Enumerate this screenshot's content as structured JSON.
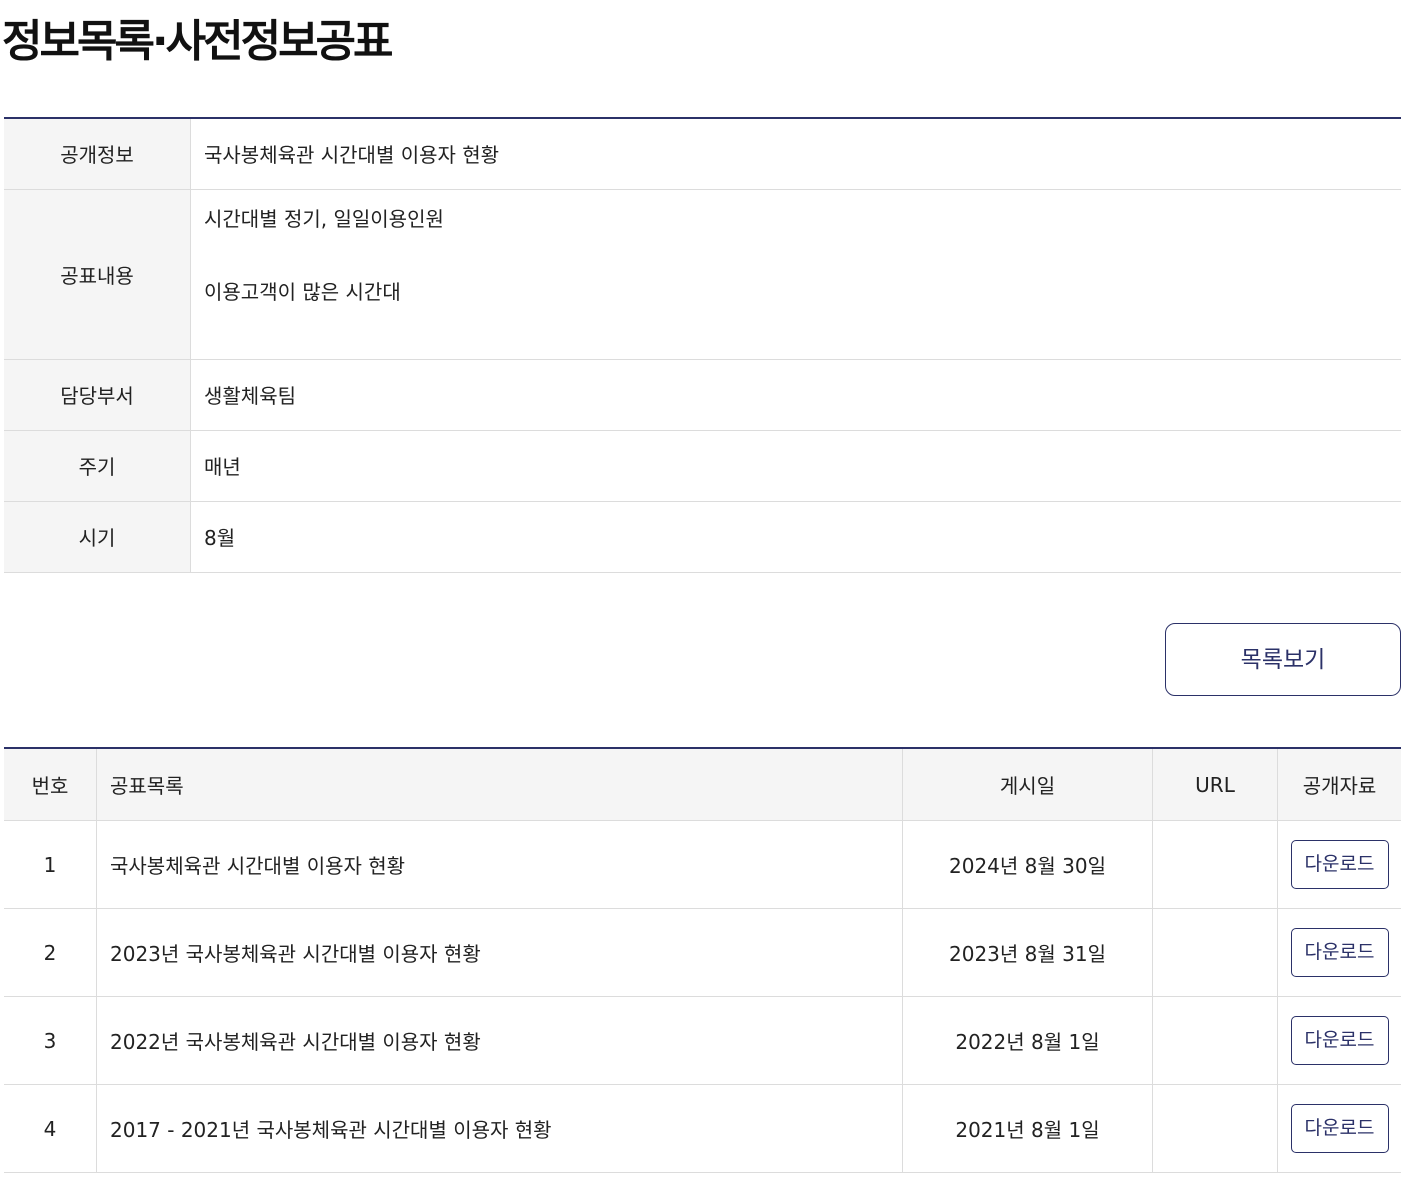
{
  "page": {
    "title": "정보목록·사전정보공표"
  },
  "info": {
    "rows": [
      {
        "label": "공개정보",
        "value": "국사봉체육관 시간대별 이용자 현황"
      },
      {
        "label": "공표내용",
        "value_line1": "시간대별 정기, 일일이용인원",
        "value_line2": "이용고객이 많은 시간대"
      },
      {
        "label": "담당부서",
        "value": "생활체육팀"
      },
      {
        "label": "주기",
        "value": "매년"
      },
      {
        "label": "시기",
        "value": "8월"
      }
    ]
  },
  "actions": {
    "list_button_label": "목록보기"
  },
  "announcements": {
    "headers": {
      "number": "번호",
      "title": "공표목록",
      "date": "게시일",
      "url": "URL",
      "file": "공개자료"
    },
    "rows": [
      {
        "number": "1",
        "title": "국사봉체육관 시간대별 이용자 현황",
        "date": "2024년 8월 30일",
        "url": "",
        "download_label": "다운로드"
      },
      {
        "number": "2",
        "title": "2023년 국사봉체육관 시간대별 이용자 현황",
        "date": "2023년 8월 31일",
        "url": "",
        "download_label": "다운로드"
      },
      {
        "number": "3",
        "title": "2022년 국사봉체육관 시간대별 이용자 현황",
        "date": "2022년 8월 1일",
        "url": "",
        "download_label": "다운로드"
      },
      {
        "number": "4",
        "title": "2017 - 2021년 국사봉체육관 시간대별 이용자 현황",
        "date": "2021년 8월 1일",
        "url": "",
        "download_label": "다운로드"
      }
    ]
  },
  "colors": {
    "accent": "#2b3168",
    "header_bg": "#f5f5f5",
    "border": "#dcdcdc"
  }
}
